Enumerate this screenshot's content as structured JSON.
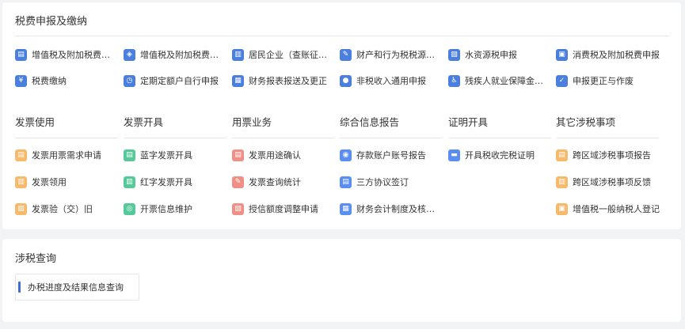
{
  "sections": {
    "declare": {
      "title": "税费申报及缴纳",
      "row1": [
        {
          "label": "增值税及附加税费申...",
          "icon": "tax-form-icon"
        },
        {
          "label": "增值税及附加税费预...",
          "icon": "stack-layers-icon"
        },
        {
          "label": "居民企业（查账征收...",
          "icon": "building-doc-icon"
        },
        {
          "label": "财产和行为税税源采...",
          "icon": "edit-form-icon"
        },
        {
          "label": "水资源税申报",
          "icon": "water-doc-icon"
        },
        {
          "label": "消费税及附加税费申报",
          "icon": "basket-icon"
        }
      ],
      "row2": [
        {
          "label": "税费缴纳",
          "icon": "coin-payment-icon"
        },
        {
          "label": "定期定额户自行申报",
          "icon": "clock-doc-icon"
        },
        {
          "label": "财务报表报送及更正",
          "icon": "report-card-icon"
        },
        {
          "label": "非税收入通用申报",
          "icon": "drop-icon"
        },
        {
          "label": "残疾人就业保障金申报",
          "icon": "wheelchair-icon"
        },
        {
          "label": "申报更正与作废",
          "icon": "correct-doc-icon"
        }
      ]
    },
    "categories": [
      {
        "title": "发票使用",
        "items": [
          {
            "label": "发票用票需求申请",
            "icon": "invoice-request-icon"
          },
          {
            "label": "发票领用",
            "icon": "invoice-receive-icon"
          },
          {
            "label": "发票验（交）旧",
            "icon": "invoice-verify-icon"
          }
        ]
      },
      {
        "title": "发票开具",
        "items": [
          {
            "label": "蓝字发票开具",
            "icon": "blue-invoice-icon"
          },
          {
            "label": "红字发票开具",
            "icon": "red-invoice-icon"
          },
          {
            "label": "开票信息维护",
            "icon": "invoice-settings-icon"
          }
        ]
      },
      {
        "title": "用票业务",
        "items": [
          {
            "label": "发票用途确认",
            "icon": "invoice-confirm-icon"
          },
          {
            "label": "发票查询统计",
            "icon": "invoice-search-icon"
          },
          {
            "label": "授信额度调整申请",
            "icon": "credit-adjust-icon"
          }
        ]
      },
      {
        "title": "综合信息报告",
        "items": [
          {
            "label": "存款账户账号报告",
            "icon": "bank-account-icon"
          },
          {
            "label": "三方协议签订",
            "icon": "agreement-icon"
          },
          {
            "label": "财务会计制度及核算...",
            "icon": "accounting-icon"
          }
        ]
      },
      {
        "title": "证明开具",
        "items": [
          {
            "label": "开具税收完税证明",
            "icon": "certificate-icon"
          }
        ]
      },
      {
        "title": "其它涉税事项",
        "items": [
          {
            "label": "跨区域涉税事项报告",
            "icon": "cross-region-report-icon"
          },
          {
            "label": "跨区域涉税事项反馈",
            "icon": "cross-region-feedback-icon"
          },
          {
            "label": "增值税一般纳税人登记",
            "icon": "vat-register-icon"
          }
        ]
      }
    ],
    "query": {
      "title": "涉税查询",
      "link": "办税进度及结果信息查询"
    }
  },
  "colors": {
    "primary_blue": "#4a7fe0",
    "orange": "#f7b96a",
    "green": "#55c99a",
    "red": "#f08f86",
    "page_bg": "#f2f3f5"
  }
}
